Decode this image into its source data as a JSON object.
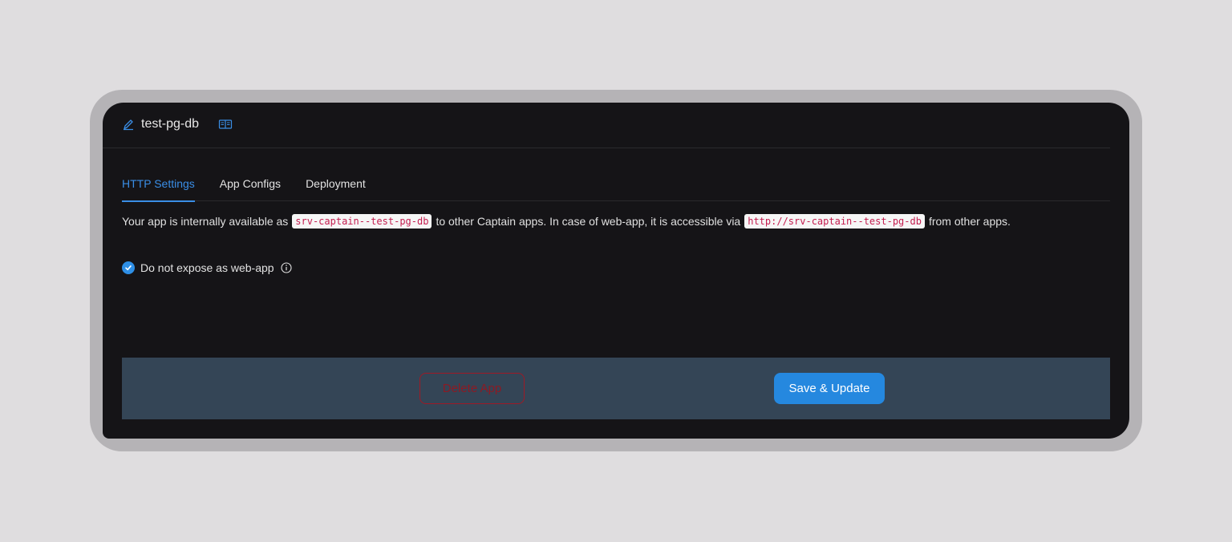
{
  "app": {
    "title": "test-pg-db",
    "edit_icon": "edit-pencil-icon",
    "docs_icon": "read-book-icon"
  },
  "tabs": [
    {
      "label": "HTTP Settings",
      "active": true
    },
    {
      "label": "App Configs",
      "active": false
    },
    {
      "label": "Deployment",
      "active": false
    }
  ],
  "http": {
    "text_1": "Your app is internally available as",
    "internal_host": "srv-captain--test-pg-db",
    "text_2": "to other Captain apps. In case of web-app, it is accessible via",
    "internal_url": "http://srv-captain--test-pg-db",
    "text_3": "from other apps.",
    "not_expose_label": "Do not expose as web-app",
    "not_expose_checked": true
  },
  "actions": {
    "delete_label": "Delete App",
    "save_label": "Save & Update"
  },
  "colors": {
    "accent": "#2588df",
    "danger": "#9d1a26",
    "card_bg": "#151417",
    "footer_bg": "#344556"
  }
}
